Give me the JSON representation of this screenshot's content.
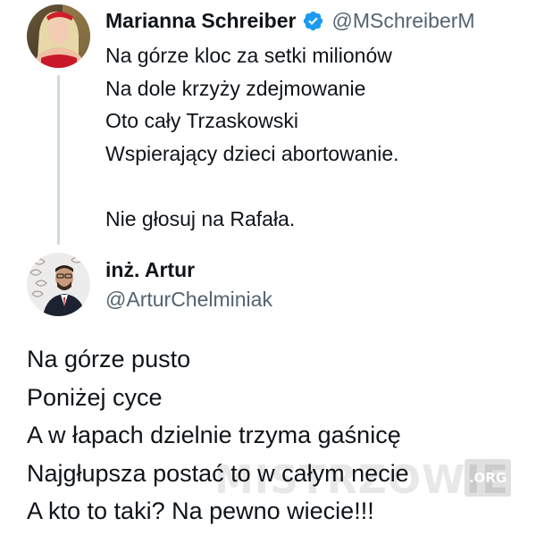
{
  "original_tweet": {
    "author_name": "Marianna Schreiber",
    "handle": "@MSchreiberM",
    "verified_icon": "verified-badge-icon",
    "lines": [
      "Na górze kloc za setki milionów",
      "Na dole krzyży zdejmowanie",
      "Oto cały Trzaskowski",
      "Wspierający dzieci abortowanie.",
      "",
      "Nie głosuj na Rafała."
    ]
  },
  "reply": {
    "author_name": "inż. Artur",
    "handle": "@ArturChelminiak",
    "lines": [
      "Na górze pusto",
      "Poniżej cyce",
      "A w łapach dzielnie trzyma gaśnicę",
      "Najgłupsza postać to w całym necie",
      "A kto to taki? Na pewno wiecie!!!"
    ]
  },
  "watermark": {
    "text": "MISTRZOWIE",
    "badge": ".ORG"
  },
  "colors": {
    "text": "#0f1419",
    "secondary": "#536471",
    "verified": "#1d9bf0",
    "thread_line": "#cfd9de"
  }
}
